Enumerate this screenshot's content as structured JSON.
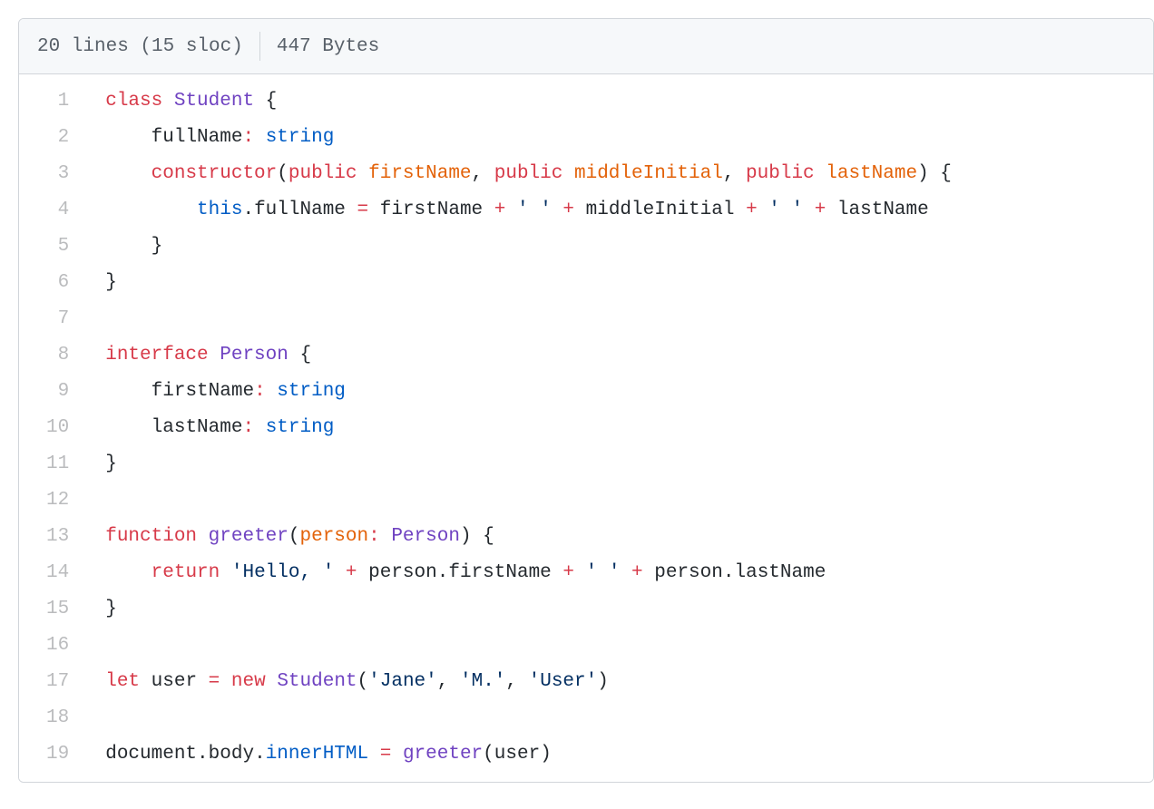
{
  "header": {
    "lines": "20 lines (15 sloc)",
    "bytes": "447 Bytes"
  },
  "lineNumbers": [
    "1",
    "2",
    "3",
    "4",
    "5",
    "6",
    "7",
    "8",
    "9",
    "10",
    "11",
    "12",
    "13",
    "14",
    "15",
    "16",
    "17",
    "18",
    "19"
  ],
  "code": [
    [
      [
        "kw",
        "class"
      ],
      [
        "pun",
        " "
      ],
      [
        "cls",
        "Student"
      ],
      [
        "pun",
        " {"
      ]
    ],
    [
      [
        "pun",
        "    "
      ],
      [
        "id",
        "fullName"
      ],
      [
        "kw",
        ":"
      ],
      [
        "pun",
        " "
      ],
      [
        "typ",
        "string"
      ]
    ],
    [
      [
        "pun",
        "    "
      ],
      [
        "kw",
        "constructor"
      ],
      [
        "pun",
        "("
      ],
      [
        "kw",
        "public"
      ],
      [
        "pun",
        " "
      ],
      [
        "var",
        "firstName"
      ],
      [
        "pun",
        ", "
      ],
      [
        "kw",
        "public"
      ],
      [
        "pun",
        " "
      ],
      [
        "var",
        "middleInitial"
      ],
      [
        "pun",
        ", "
      ],
      [
        "kw",
        "public"
      ],
      [
        "pun",
        " "
      ],
      [
        "var",
        "lastName"
      ],
      [
        "pun",
        ") {"
      ]
    ],
    [
      [
        "pun",
        "        "
      ],
      [
        "typ",
        "this"
      ],
      [
        "pun",
        "."
      ],
      [
        "id",
        "fullName"
      ],
      [
        "pun",
        " "
      ],
      [
        "kw",
        "="
      ],
      [
        "pun",
        " "
      ],
      [
        "id",
        "firstName"
      ],
      [
        "pun",
        " "
      ],
      [
        "kw",
        "+"
      ],
      [
        "pun",
        " "
      ],
      [
        "str",
        "' '"
      ],
      [
        "pun",
        " "
      ],
      [
        "kw",
        "+"
      ],
      [
        "pun",
        " "
      ],
      [
        "id",
        "middleInitial"
      ],
      [
        "pun",
        " "
      ],
      [
        "kw",
        "+"
      ],
      [
        "pun",
        " "
      ],
      [
        "str",
        "' '"
      ],
      [
        "pun",
        " "
      ],
      [
        "kw",
        "+"
      ],
      [
        "pun",
        " "
      ],
      [
        "id",
        "lastName"
      ]
    ],
    [
      [
        "pun",
        "    }"
      ]
    ],
    [
      [
        "pun",
        "}"
      ]
    ],
    [
      [
        "pun",
        ""
      ]
    ],
    [
      [
        "kw",
        "interface"
      ],
      [
        "pun",
        " "
      ],
      [
        "cls",
        "Person"
      ],
      [
        "pun",
        " {"
      ]
    ],
    [
      [
        "pun",
        "    "
      ],
      [
        "id",
        "firstName"
      ],
      [
        "kw",
        ":"
      ],
      [
        "pun",
        " "
      ],
      [
        "typ",
        "string"
      ]
    ],
    [
      [
        "pun",
        "    "
      ],
      [
        "id",
        "lastName"
      ],
      [
        "kw",
        ":"
      ],
      [
        "pun",
        " "
      ],
      [
        "typ",
        "string"
      ]
    ],
    [
      [
        "pun",
        "}"
      ]
    ],
    [
      [
        "pun",
        ""
      ]
    ],
    [
      [
        "kw",
        "function"
      ],
      [
        "pun",
        " "
      ],
      [
        "cls",
        "greeter"
      ],
      [
        "pun",
        "("
      ],
      [
        "var",
        "person"
      ],
      [
        "kw",
        ":"
      ],
      [
        "pun",
        " "
      ],
      [
        "cls",
        "Person"
      ],
      [
        "pun",
        ") {"
      ]
    ],
    [
      [
        "pun",
        "    "
      ],
      [
        "kw",
        "return"
      ],
      [
        "pun",
        " "
      ],
      [
        "str",
        "'Hello, '"
      ],
      [
        "pun",
        " "
      ],
      [
        "kw",
        "+"
      ],
      [
        "pun",
        " "
      ],
      [
        "id",
        "person"
      ],
      [
        "pun",
        "."
      ],
      [
        "id",
        "firstName"
      ],
      [
        "pun",
        " "
      ],
      [
        "kw",
        "+"
      ],
      [
        "pun",
        " "
      ],
      [
        "str",
        "' '"
      ],
      [
        "pun",
        " "
      ],
      [
        "kw",
        "+"
      ],
      [
        "pun",
        " "
      ],
      [
        "id",
        "person"
      ],
      [
        "pun",
        "."
      ],
      [
        "id",
        "lastName"
      ]
    ],
    [
      [
        "pun",
        "}"
      ]
    ],
    [
      [
        "pun",
        ""
      ]
    ],
    [
      [
        "kw",
        "let"
      ],
      [
        "pun",
        " "
      ],
      [
        "id",
        "user"
      ],
      [
        "pun",
        " "
      ],
      [
        "kw",
        "="
      ],
      [
        "pun",
        " "
      ],
      [
        "kw",
        "new"
      ],
      [
        "pun",
        " "
      ],
      [
        "cls",
        "Student"
      ],
      [
        "pun",
        "("
      ],
      [
        "str",
        "'Jane'"
      ],
      [
        "pun",
        ", "
      ],
      [
        "str",
        "'M.'"
      ],
      [
        "pun",
        ", "
      ],
      [
        "str",
        "'User'"
      ],
      [
        "pun",
        ")"
      ]
    ],
    [
      [
        "pun",
        ""
      ]
    ],
    [
      [
        "id",
        "document"
      ],
      [
        "pun",
        "."
      ],
      [
        "id",
        "body"
      ],
      [
        "pun",
        "."
      ],
      [
        "typ",
        "innerHTML"
      ],
      [
        "pun",
        " "
      ],
      [
        "kw",
        "="
      ],
      [
        "pun",
        " "
      ],
      [
        "cls",
        "greeter"
      ],
      [
        "pun",
        "("
      ],
      [
        "id",
        "user"
      ],
      [
        "pun",
        ")"
      ]
    ]
  ]
}
